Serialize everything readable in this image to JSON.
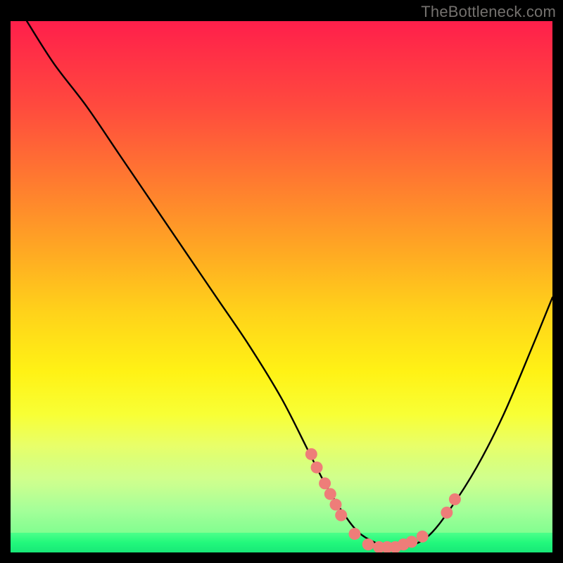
{
  "watermark": "TheBottleneck.com",
  "chart_data": {
    "type": "line",
    "title": "",
    "xlabel": "",
    "ylabel": "",
    "xlim": [
      0,
      100
    ],
    "ylim": [
      0,
      100
    ],
    "series": [
      {
        "name": "curve",
        "x": [
          3,
          8,
          14,
          20,
          26,
          32,
          38,
          44,
          50,
          55,
          58,
          61,
          64,
          67,
          70,
          73,
          77,
          81,
          86,
          91,
          96,
          100
        ],
        "y": [
          100,
          92,
          84,
          75,
          66,
          57,
          48,
          39,
          29,
          19,
          13,
          8,
          4,
          2,
          1,
          1,
          3,
          8,
          16,
          26,
          38,
          48
        ]
      }
    ],
    "markers": {
      "name": "points",
      "x": [
        55.5,
        56.5,
        58.0,
        59.0,
        60.0,
        61.0,
        63.5,
        66.0,
        68.0,
        69.5,
        71.0,
        72.5,
        74.0,
        76.0,
        80.5,
        82.0
      ],
      "y": [
        18.5,
        16.0,
        13.0,
        11.0,
        9.0,
        7.0,
        3.5,
        1.5,
        1.0,
        1.0,
        1.0,
        1.5,
        2.0,
        3.0,
        7.5,
        10.0
      ]
    },
    "colors": {
      "curve": "#000000",
      "marker_fill": "#ee7d79",
      "marker_stroke": "#ee7d79",
      "gradient_top": "#ff1f4b",
      "gradient_mid": "#ffd31a",
      "gradient_bottom": "#2bfd83"
    }
  }
}
